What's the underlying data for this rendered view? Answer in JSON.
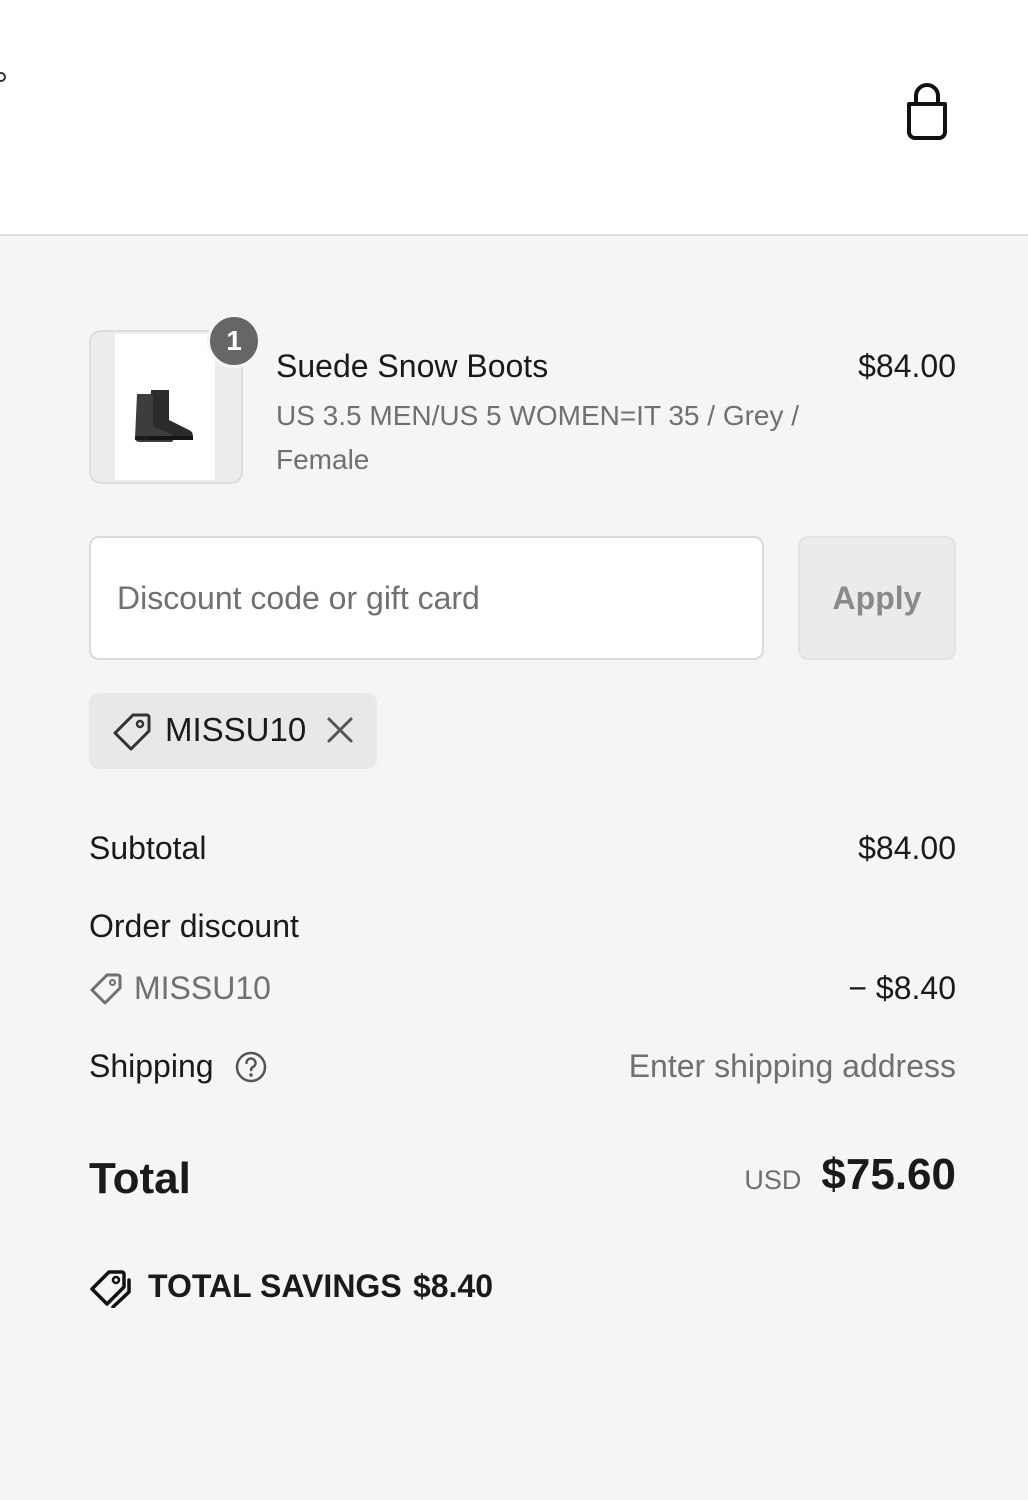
{
  "header": {
    "cart_icon": "shopping-bag-icon"
  },
  "line_item": {
    "quantity": "1",
    "title": "Suede Snow Boots",
    "variant": "US 3.5 MEN/US 5 WOMEN=IT 35 / Grey / Female",
    "price": "$84.00",
    "image_icon": "boot-icon"
  },
  "discount": {
    "placeholder": "Discount code or gift card",
    "value": "",
    "apply_label": "Apply",
    "applied_code": "MISSU10",
    "tag_icon": "tag-icon",
    "remove_icon": "close-icon"
  },
  "summary": {
    "subtotal_label": "Subtotal",
    "subtotal_value": "$84.00",
    "order_discount_label": "Order discount",
    "order_discount_code": "MISSU10",
    "order_discount_value": "− $8.40",
    "shipping_label": "Shipping",
    "shipping_help_icon": "question-circle-icon",
    "shipping_value": "Enter shipping address",
    "total_label": "Total",
    "total_currency": "USD",
    "total_value": "$75.60",
    "savings_icon": "tags-icon",
    "savings_label": "TOTAL SAVINGS",
    "savings_value": "$8.40"
  },
  "colors": {
    "page_bg": "#f5f5f5",
    "header_bg": "#ffffff",
    "text": "#1a1a1a",
    "muted": "#707070",
    "badge": "#666666"
  }
}
